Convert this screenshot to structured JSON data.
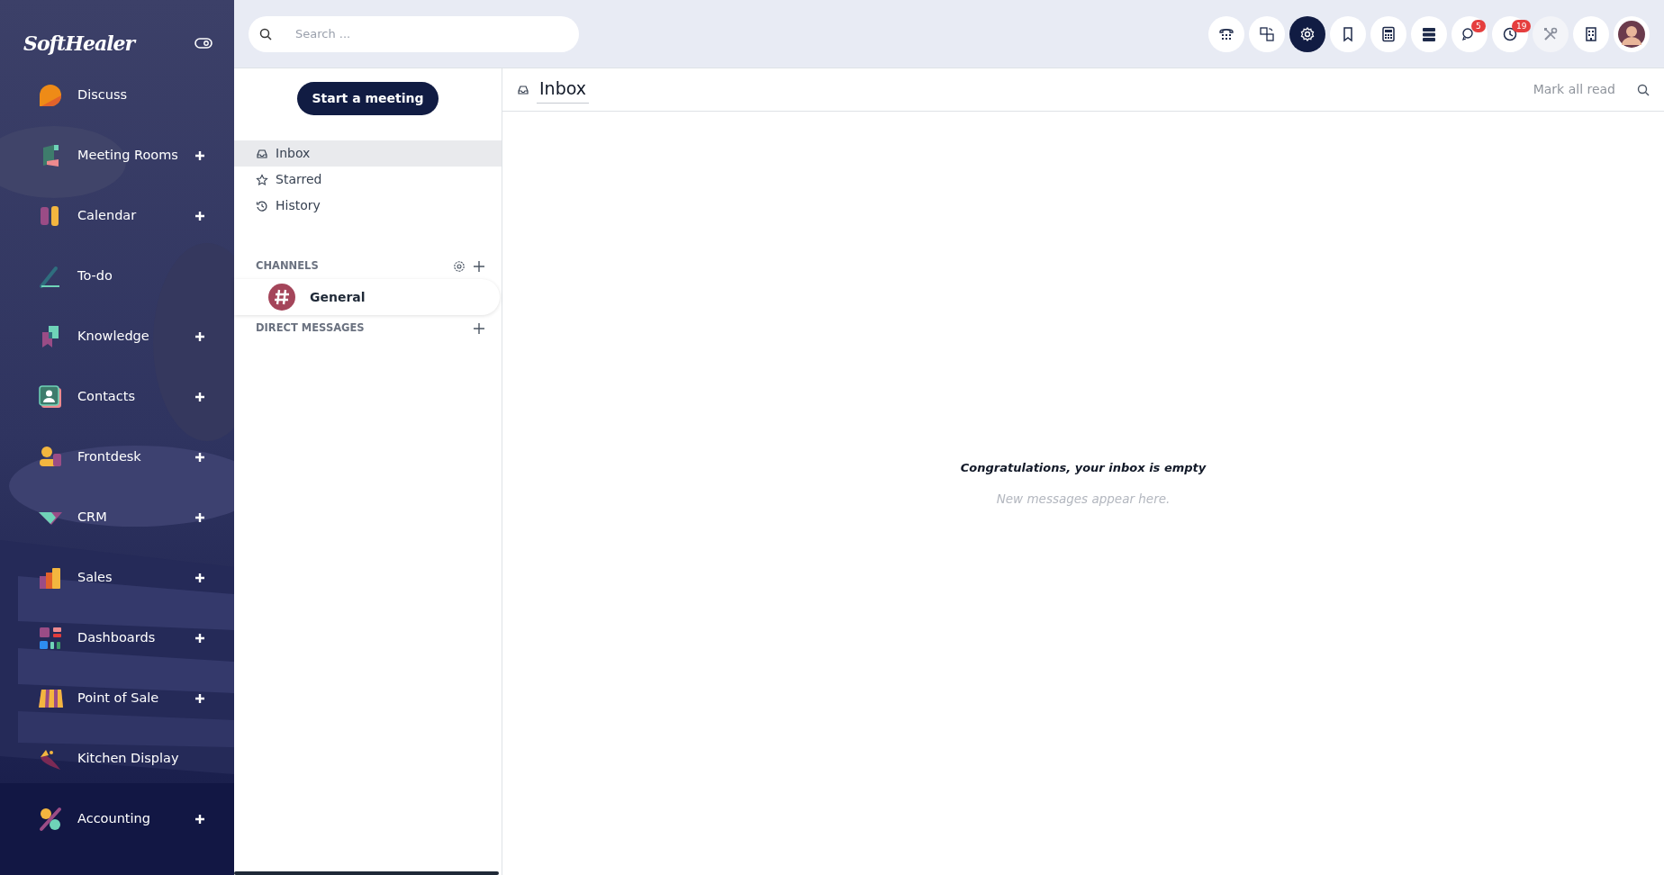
{
  "sidebar": {
    "brand": "SoftHealer",
    "items": [
      {
        "label": "Discuss",
        "add": false
      },
      {
        "label": "Meeting Rooms",
        "add": true
      },
      {
        "label": "Calendar",
        "add": true
      },
      {
        "label": "To-do",
        "add": false
      },
      {
        "label": "Knowledge",
        "add": true
      },
      {
        "label": "Contacts",
        "add": true
      },
      {
        "label": "Frontdesk",
        "add": true
      },
      {
        "label": "CRM",
        "add": true
      },
      {
        "label": "Sales",
        "add": true
      },
      {
        "label": "Dashboards",
        "add": true
      },
      {
        "label": "Point of Sale",
        "add": true
      },
      {
        "label": "Kitchen Display",
        "add": false
      },
      {
        "label": "Accounting",
        "add": true
      }
    ]
  },
  "topbar": {
    "search": {
      "placeholder": "Search ..."
    },
    "buttons": [
      {
        "selected": false,
        "disabled": false
      },
      {
        "selected": false,
        "disabled": false
      },
      {
        "selected": true,
        "disabled": false
      },
      {
        "selected": false,
        "disabled": false
      },
      {
        "selected": false,
        "disabled": false
      },
      {
        "selected": false,
        "disabled": false
      },
      {
        "selected": false,
        "disabled": false,
        "badge": "5"
      },
      {
        "selected": false,
        "disabled": false,
        "badge": "19"
      },
      {
        "selected": false,
        "disabled": true
      },
      {
        "selected": false,
        "disabled": false
      }
    ]
  },
  "mailboxes": {
    "start_button": "Start a meeting",
    "items": [
      {
        "label": "Inbox",
        "selected": true
      },
      {
        "label": "Starred",
        "selected": false
      },
      {
        "label": "History",
        "selected": false
      }
    ],
    "channels": {
      "title": "CHANNELS",
      "items": [
        {
          "label": "General"
        }
      ]
    },
    "direct_messages": {
      "title": "DIRECT MESSAGES"
    }
  },
  "main": {
    "title": "Inbox",
    "mark_all_read": "Mark all read",
    "empty_title": "Congratulations, your inbox is empty",
    "empty_hint": "New messages appear here."
  }
}
